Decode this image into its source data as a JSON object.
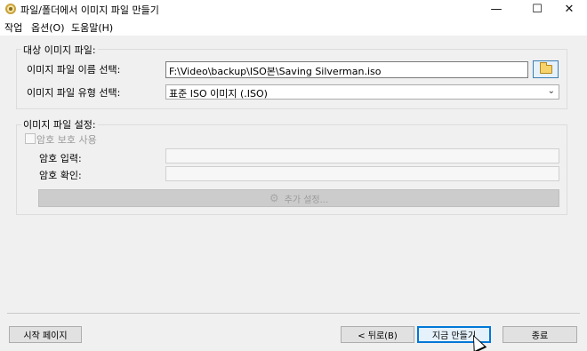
{
  "window": {
    "title": "파일/폴더에서 이미지 파일 만들기",
    "minimize_glyph": "—",
    "maximize_glyph": "☐",
    "close_glyph": "✕"
  },
  "menu": {
    "items": [
      "작업",
      "옵션(O)",
      "도움말(H)"
    ]
  },
  "source_group": {
    "title": "대상 이미지 파일:",
    "file_name_label": "이미지 파일 이름 선택:",
    "file_name_value": "F:\\Video\\backup\\ISO본\\Saving Silverman.iso",
    "file_type_label": "이미지 파일 유형 선택:",
    "file_type_value": "표준 ISO 이미지 (.ISO)",
    "browse_icon": "folder-open-icon"
  },
  "settings_group": {
    "title": "이미지 파일 설정:",
    "use_password_label": "암호 보호 사용",
    "use_password_checked": false,
    "password_label": "암호 입력:",
    "password_value": "",
    "confirm_label": "암호 확인:",
    "confirm_value": "",
    "advanced_label": "추가 설정...",
    "advanced_icon": "gear-icon"
  },
  "footer": {
    "start_page_label": "시작 페이지",
    "back_label": "< 뒤로(B)",
    "make_now_label": "지금 만들기",
    "close_label": "종료"
  },
  "colors": {
    "accent": "#0078d7",
    "dialog_bg": "#f0f0f0"
  }
}
